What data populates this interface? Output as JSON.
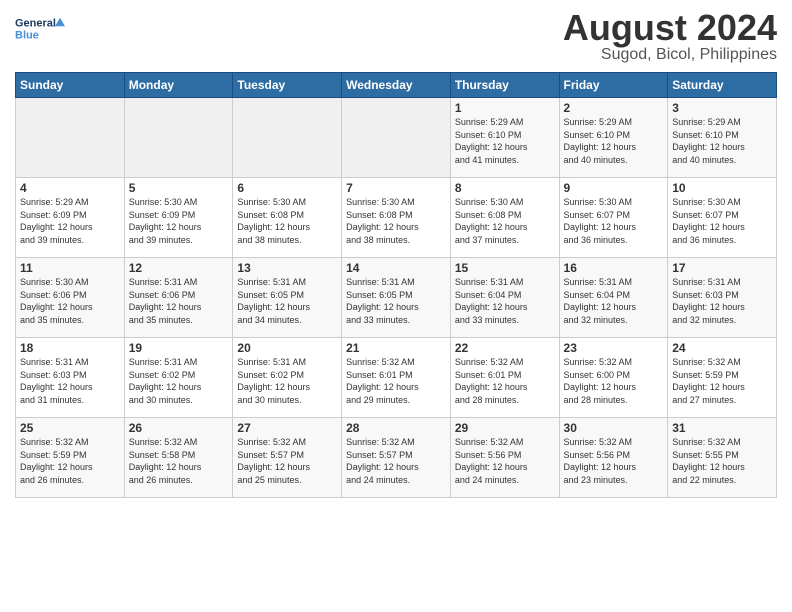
{
  "header": {
    "logo_line1": "General",
    "logo_line2": "Blue",
    "main_title": "August 2024",
    "subtitle": "Sugod, Bicol, Philippines"
  },
  "days_of_week": [
    "Sunday",
    "Monday",
    "Tuesday",
    "Wednesday",
    "Thursday",
    "Friday",
    "Saturday"
  ],
  "weeks": [
    [
      {
        "day": "",
        "info": ""
      },
      {
        "day": "",
        "info": ""
      },
      {
        "day": "",
        "info": ""
      },
      {
        "day": "",
        "info": ""
      },
      {
        "day": "1",
        "info": "Sunrise: 5:29 AM\nSunset: 6:10 PM\nDaylight: 12 hours\nand 41 minutes."
      },
      {
        "day": "2",
        "info": "Sunrise: 5:29 AM\nSunset: 6:10 PM\nDaylight: 12 hours\nand 40 minutes."
      },
      {
        "day": "3",
        "info": "Sunrise: 5:29 AM\nSunset: 6:10 PM\nDaylight: 12 hours\nand 40 minutes."
      }
    ],
    [
      {
        "day": "4",
        "info": "Sunrise: 5:29 AM\nSunset: 6:09 PM\nDaylight: 12 hours\nand 39 minutes."
      },
      {
        "day": "5",
        "info": "Sunrise: 5:30 AM\nSunset: 6:09 PM\nDaylight: 12 hours\nand 39 minutes."
      },
      {
        "day": "6",
        "info": "Sunrise: 5:30 AM\nSunset: 6:08 PM\nDaylight: 12 hours\nand 38 minutes."
      },
      {
        "day": "7",
        "info": "Sunrise: 5:30 AM\nSunset: 6:08 PM\nDaylight: 12 hours\nand 38 minutes."
      },
      {
        "day": "8",
        "info": "Sunrise: 5:30 AM\nSunset: 6:08 PM\nDaylight: 12 hours\nand 37 minutes."
      },
      {
        "day": "9",
        "info": "Sunrise: 5:30 AM\nSunset: 6:07 PM\nDaylight: 12 hours\nand 36 minutes."
      },
      {
        "day": "10",
        "info": "Sunrise: 5:30 AM\nSunset: 6:07 PM\nDaylight: 12 hours\nand 36 minutes."
      }
    ],
    [
      {
        "day": "11",
        "info": "Sunrise: 5:30 AM\nSunset: 6:06 PM\nDaylight: 12 hours\nand 35 minutes."
      },
      {
        "day": "12",
        "info": "Sunrise: 5:31 AM\nSunset: 6:06 PM\nDaylight: 12 hours\nand 35 minutes."
      },
      {
        "day": "13",
        "info": "Sunrise: 5:31 AM\nSunset: 6:05 PM\nDaylight: 12 hours\nand 34 minutes."
      },
      {
        "day": "14",
        "info": "Sunrise: 5:31 AM\nSunset: 6:05 PM\nDaylight: 12 hours\nand 33 minutes."
      },
      {
        "day": "15",
        "info": "Sunrise: 5:31 AM\nSunset: 6:04 PM\nDaylight: 12 hours\nand 33 minutes."
      },
      {
        "day": "16",
        "info": "Sunrise: 5:31 AM\nSunset: 6:04 PM\nDaylight: 12 hours\nand 32 minutes."
      },
      {
        "day": "17",
        "info": "Sunrise: 5:31 AM\nSunset: 6:03 PM\nDaylight: 12 hours\nand 32 minutes."
      }
    ],
    [
      {
        "day": "18",
        "info": "Sunrise: 5:31 AM\nSunset: 6:03 PM\nDaylight: 12 hours\nand 31 minutes."
      },
      {
        "day": "19",
        "info": "Sunrise: 5:31 AM\nSunset: 6:02 PM\nDaylight: 12 hours\nand 30 minutes."
      },
      {
        "day": "20",
        "info": "Sunrise: 5:31 AM\nSunset: 6:02 PM\nDaylight: 12 hours\nand 30 minutes."
      },
      {
        "day": "21",
        "info": "Sunrise: 5:32 AM\nSunset: 6:01 PM\nDaylight: 12 hours\nand 29 minutes."
      },
      {
        "day": "22",
        "info": "Sunrise: 5:32 AM\nSunset: 6:01 PM\nDaylight: 12 hours\nand 28 minutes."
      },
      {
        "day": "23",
        "info": "Sunrise: 5:32 AM\nSunset: 6:00 PM\nDaylight: 12 hours\nand 28 minutes."
      },
      {
        "day": "24",
        "info": "Sunrise: 5:32 AM\nSunset: 5:59 PM\nDaylight: 12 hours\nand 27 minutes."
      }
    ],
    [
      {
        "day": "25",
        "info": "Sunrise: 5:32 AM\nSunset: 5:59 PM\nDaylight: 12 hours\nand 26 minutes."
      },
      {
        "day": "26",
        "info": "Sunrise: 5:32 AM\nSunset: 5:58 PM\nDaylight: 12 hours\nand 26 minutes."
      },
      {
        "day": "27",
        "info": "Sunrise: 5:32 AM\nSunset: 5:57 PM\nDaylight: 12 hours\nand 25 minutes."
      },
      {
        "day": "28",
        "info": "Sunrise: 5:32 AM\nSunset: 5:57 PM\nDaylight: 12 hours\nand 24 minutes."
      },
      {
        "day": "29",
        "info": "Sunrise: 5:32 AM\nSunset: 5:56 PM\nDaylight: 12 hours\nand 24 minutes."
      },
      {
        "day": "30",
        "info": "Sunrise: 5:32 AM\nSunset: 5:56 PM\nDaylight: 12 hours\nand 23 minutes."
      },
      {
        "day": "31",
        "info": "Sunrise: 5:32 AM\nSunset: 5:55 PM\nDaylight: 12 hours\nand 22 minutes."
      }
    ]
  ]
}
